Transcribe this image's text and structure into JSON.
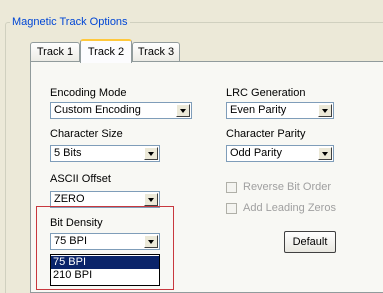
{
  "group": {
    "title": "Magnetic Track Options"
  },
  "tabs": [
    {
      "label": "Track 1",
      "active": false
    },
    {
      "label": "Track 2",
      "active": true
    },
    {
      "label": "Track 3",
      "active": false
    }
  ],
  "encoding_mode": {
    "label": "Encoding Mode",
    "value": "Custom Encoding"
  },
  "character_size": {
    "label": "Character Size",
    "value": "5 Bits"
  },
  "ascii_offset": {
    "label": "ASCII Offset",
    "value": "ZERO"
  },
  "bit_density": {
    "label": "Bit Density",
    "value": "75 BPI",
    "options": [
      "75 BPI",
      "210 BPI"
    ],
    "selected_index": 0
  },
  "lrc_generation": {
    "label": "LRC Generation",
    "value": "Even Parity"
  },
  "character_parity": {
    "label": "Character Parity",
    "value": "Odd Parity"
  },
  "reverse_bit_order": {
    "label": "Reverse Bit Order",
    "checked": false,
    "enabled": false
  },
  "add_leading_zeros": {
    "label": "Add Leading Zeros",
    "checked": false,
    "enabled": false
  },
  "default_button": {
    "label": "Default"
  },
  "colors": {
    "highlight_box": "#c8383e",
    "selection": "#0a246a",
    "group_title": "#0046d5"
  }
}
